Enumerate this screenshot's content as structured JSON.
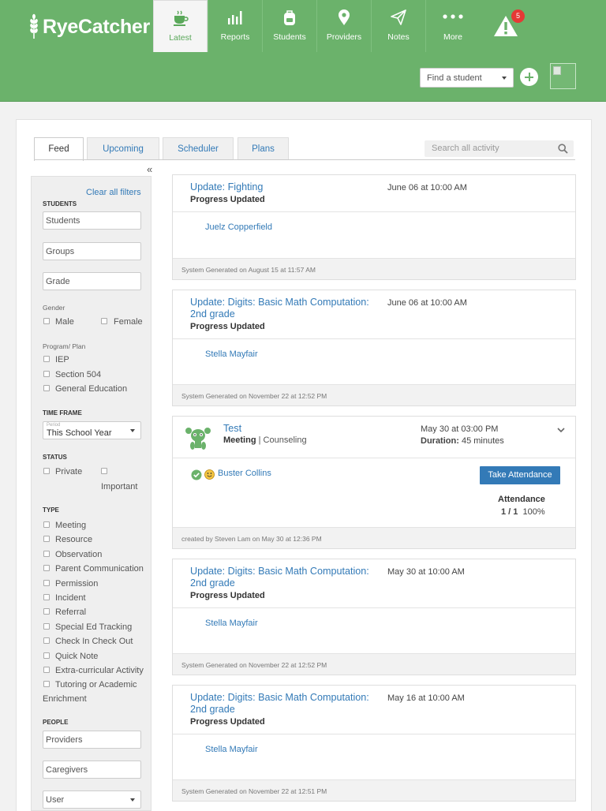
{
  "app": {
    "name": "RyeCatcher"
  },
  "nav": {
    "tabs": [
      {
        "label": "Latest",
        "icon": "coffee-cup-icon",
        "active": true
      },
      {
        "label": "Reports",
        "icon": "bar-chart-icon"
      },
      {
        "label": "Students",
        "icon": "backpack-icon"
      },
      {
        "label": "Providers",
        "icon": "map-pin-icon"
      },
      {
        "label": "Notes",
        "icon": "paper-plane-icon"
      },
      {
        "label": "More",
        "icon": "more-dots-icon"
      }
    ],
    "alert": {
      "icon": "warning-triangle-icon",
      "count": "5"
    }
  },
  "header": {
    "find_student_placeholder": "Find a student",
    "add_icon": "plus-circle-icon",
    "avatar": "user-avatar"
  },
  "feed_tabs": [
    "Feed",
    "Upcoming",
    "Scheduler",
    "Plans"
  ],
  "feed_search_placeholder": "Search all activity",
  "colors": {
    "brand_green": "#6bb26b",
    "link_blue": "#337ab7",
    "button_blue": "#337ab7",
    "alert_red": "#e53935"
  },
  "filters": {
    "clear_all": "Clear all filters",
    "students_header": "STUDENTS",
    "students_placeholder": "Students",
    "groups_placeholder": "Groups",
    "grade_placeholder": "Grade",
    "gender_label": "Gender",
    "gender_options": [
      "Male",
      "Female"
    ],
    "program_label": "Program/ Plan",
    "program_options": [
      "IEP",
      "Section 504",
      "General Education"
    ],
    "time_frame_header": "TIME FRAME",
    "time_frame_small": "Period",
    "time_frame_value": "This School Year",
    "status_header": "STATUS",
    "status_options": [
      "Private",
      "Important"
    ],
    "type_header": "TYPE",
    "type_options": [
      "Meeting",
      "Resource",
      "Observation",
      "Parent Communication",
      "Permission",
      "Incident",
      "Referral",
      "Special Ed Tracking",
      "Check In Check Out",
      "Quick Note",
      "Extra-curricular Activity",
      "Tutoring or Academic"
    ],
    "type_continuation": "Enrichment",
    "people_header": "PEOPLE",
    "providers_placeholder": "Providers",
    "caregivers_placeholder": "Caregivers",
    "user_value": "User"
  },
  "cards": [
    {
      "title": "Update: Fighting",
      "subtitle": "Progress Updated",
      "date": "June 06 at  10:00 AM",
      "student": "Juelz Copperfield",
      "footer": "System Generated on August 15 at 11:57 AM"
    },
    {
      "title": "Update: Digits: Basic Math Computation: 2nd grade",
      "subtitle": "Progress Updated",
      "date": "June 06 at  10:00 AM",
      "student": "Stella Mayfair",
      "footer": "System Generated on November 22 at 12:52 PM"
    },
    {
      "title": "Test",
      "type": "Meeting",
      "separator": "|",
      "category": "Counseling",
      "date": "May 30 at  03:00 PM",
      "duration_label": "Duration:",
      "duration": "45 minutes",
      "student": "Buster Collins",
      "button": "Take Attendance",
      "attendance_label": "Attendance",
      "attendance_count": "1 / 1",
      "attendance_pct": "100%",
      "footer": "created by Steven Lam on May 30 at 12:36 PM"
    },
    {
      "title": "Update: Digits: Basic Math Computation: 2nd grade",
      "subtitle": "Progress Updated",
      "date": "May 30 at  10:00 AM",
      "student": "Stella Mayfair",
      "footer": "System Generated on November 22 at 12:52 PM"
    },
    {
      "title": "Update: Digits: Basic Math Computation: 2nd grade",
      "subtitle": "Progress Updated",
      "date": "May 16 at  10:00 AM",
      "student": "Stella Mayfair",
      "footer": "System Generated on November 22 at 12:51 PM"
    }
  ]
}
